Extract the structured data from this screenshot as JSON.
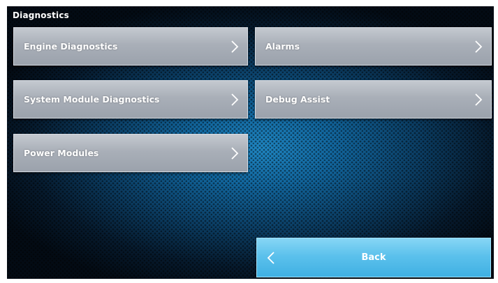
{
  "screen": {
    "title": "Diagnostics"
  },
  "buttons": {
    "engine_diagnostics": "Engine Diagnostics",
    "alarms": "Alarms",
    "system_module_diagnostics": "System Module Diagnostics",
    "debug_assist": "Debug Assist",
    "power_modules": "Power Modules",
    "back": "Back"
  },
  "icons": {
    "forward": "chevron-right-icon",
    "back": "chevron-left-icon"
  },
  "colors": {
    "menu_button": "#a9afb8",
    "back_button": "#5cc1ec",
    "background_accent": "#1f86c2"
  }
}
